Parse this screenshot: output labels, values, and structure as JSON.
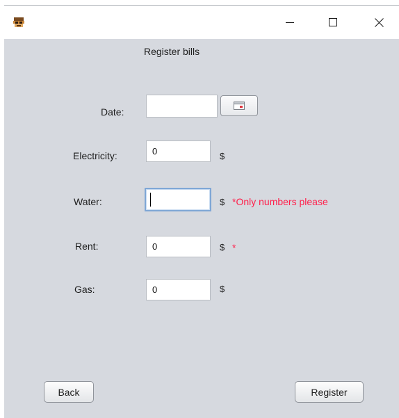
{
  "window": {
    "app_icon": "app-icon",
    "controls": {
      "minimize_icon": "minimize-icon",
      "maximize_icon": "maximize-icon",
      "close_icon": "close-icon"
    }
  },
  "form": {
    "title": "Register bills",
    "date": {
      "label": "Date:",
      "value": "",
      "picker_icon": "calendar-icon"
    },
    "electricity": {
      "label": "Electricity:",
      "value": "0",
      "currency": "$"
    },
    "water": {
      "label": "Water:",
      "value": "",
      "currency": "$",
      "error": "*Only numbers please"
    },
    "rent": {
      "label": "Rent:",
      "value": "0",
      "currency": "$",
      "error": "*"
    },
    "gas": {
      "label": "Gas:",
      "value": "0",
      "currency": "$"
    }
  },
  "buttons": {
    "back": "Back",
    "register": "Register"
  },
  "colors": {
    "background": "#d6d9df",
    "error": "#ff1f4a",
    "focus_border": "#7fa7d6"
  }
}
